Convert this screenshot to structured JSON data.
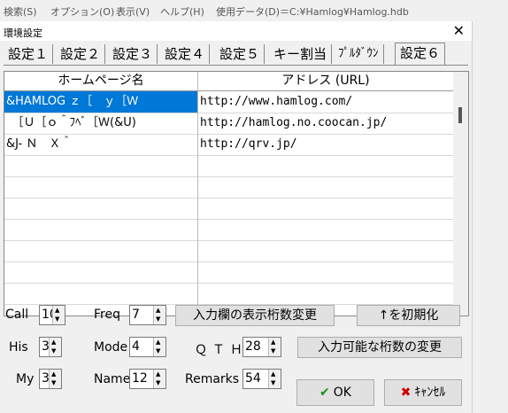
{
  "menubar": {
    "items": [
      "検索(S)",
      "オプション(O)",
      "表示(V)",
      "ヘルプ(H)",
      "使用データ(D)＝C:¥Hamlog¥Hamlog.hdb"
    ]
  },
  "dialog": {
    "title": "環境設定",
    "close_icon": "close-icon",
    "tabs": [
      "設定１",
      "設定２",
      "設定３",
      "設定４",
      "設定５",
      "キー割当",
      "ﾌﾟﾙﾀﾞｳﾝ",
      "設定６"
    ],
    "active_tab": "設定６"
  },
  "grid": {
    "columns": [
      "ホームページ名",
      "アドレス (URL)"
    ],
    "rows": [
      {
        "name": "&HAMLOG ｚ［　ｙ［Ｗ",
        "url": "http://www.hamlog.com/",
        "selected": true
      },
      {
        "name": "　［Ｕ［ｏ＾ﾌﾍﾞ［Ｗ(&U)",
        "url": "http://hamlog.no.coocan.jp/",
        "selected": false
      },
      {
        "name": "&J- Ｎ　Ｘ＾",
        "url": "http://qrv.jp/",
        "selected": false
      },
      {
        "name": "",
        "url": "",
        "selected": false
      },
      {
        "name": "",
        "url": "",
        "selected": false
      },
      {
        "name": "",
        "url": "",
        "selected": false
      },
      {
        "name": "",
        "url": "",
        "selected": false
      },
      {
        "name": "",
        "url": "",
        "selected": false
      },
      {
        "name": "",
        "url": "",
        "selected": false
      },
      {
        "name": "",
        "url": "",
        "selected": false
      },
      {
        "name": "",
        "url": "",
        "selected": false
      }
    ]
  },
  "settings": {
    "call_label": "Call",
    "call_value": "10",
    "his_label": "His",
    "his_value": "3",
    "my_label": "My",
    "my_value": "3",
    "freq_label": "Freq",
    "freq_value": "7",
    "mode_label": "Mode",
    "mode_value": "4",
    "name_label": "Name",
    "name_value": "12",
    "qth_label": "ＱＴＨ",
    "qth_value": "28",
    "remarks_label": "Remarks",
    "remarks_value": "54"
  },
  "buttons": {
    "change_digits": "入力欄の表示桁数変更",
    "reset": "↑を初期化",
    "change_max": "入力可能な桁数の変更",
    "ok": "OK",
    "cancel": "ｷｬﾝｾﾙ"
  },
  "colors": {
    "selection": "#0078d7",
    "ok_check": "#1d8f1d",
    "cancel_x": "#cc0000"
  }
}
